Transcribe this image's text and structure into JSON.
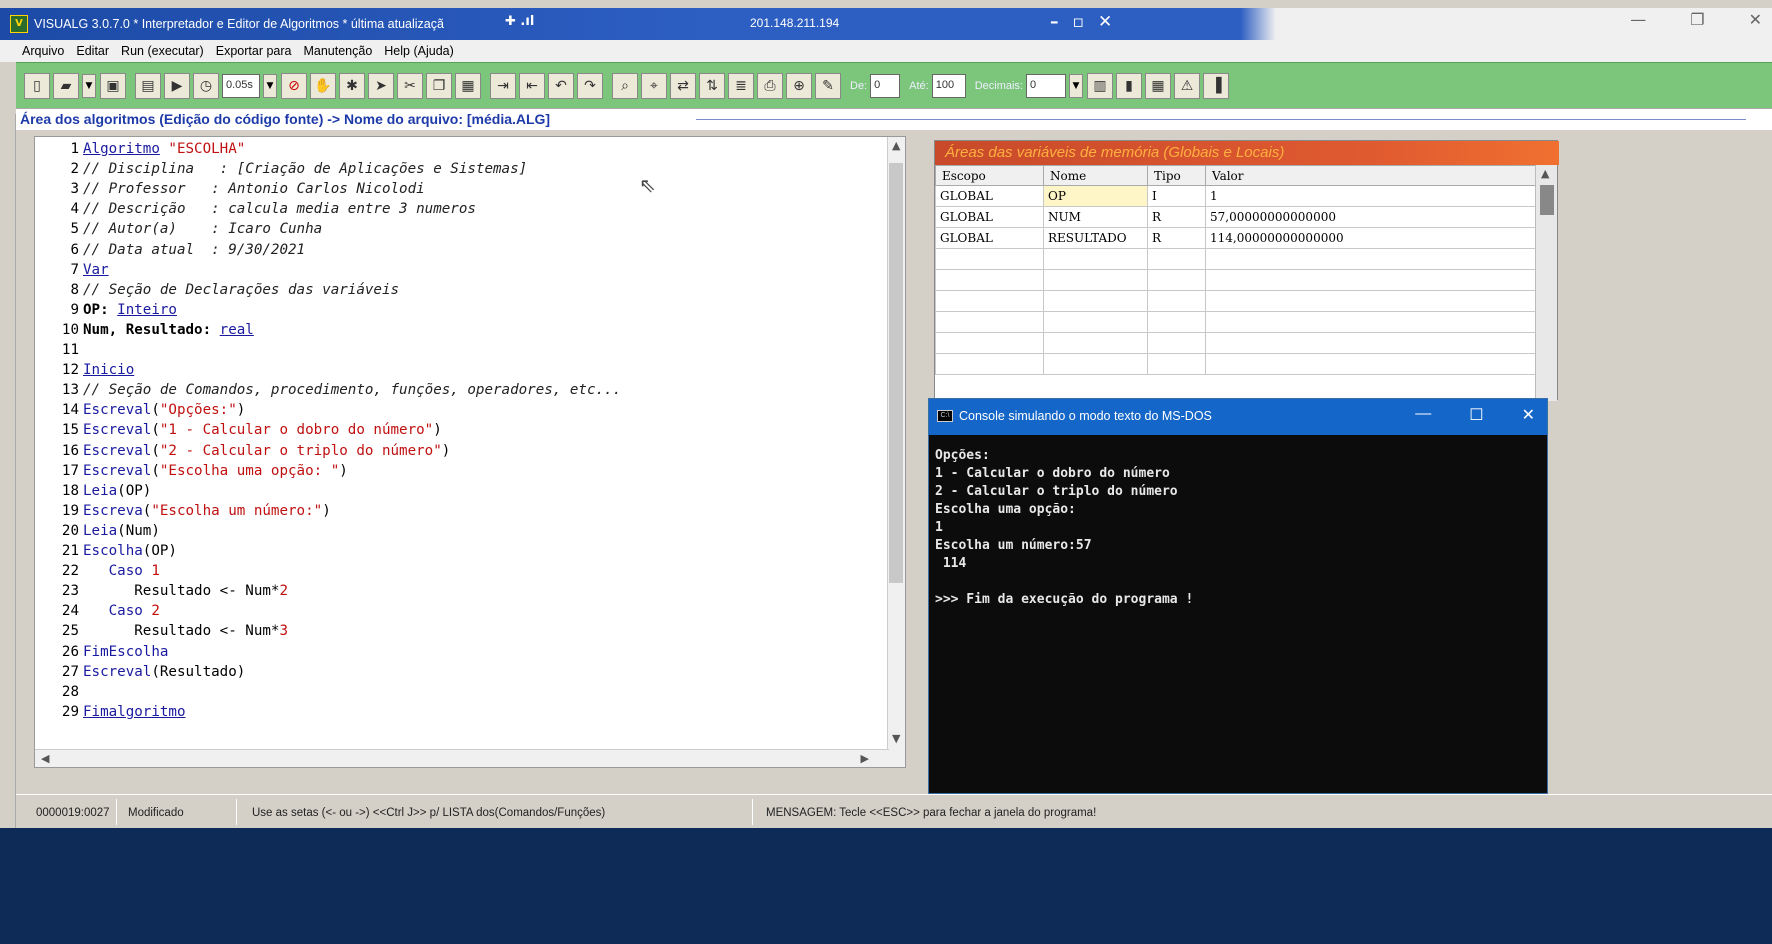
{
  "window": {
    "title": "VISUALG 3.0.7.0 * Interpretador e Editor de Algoritmos * última atualizaçã",
    "remote_ip": "201.148.211.194",
    "remote_controls": [
      "–",
      "▫",
      "✕"
    ],
    "window_controls": [
      "—",
      "❐",
      "✕"
    ]
  },
  "menu": [
    "Arquivo",
    "Editar",
    "Run (executar)",
    "Exportar para",
    "Manutenção",
    "Help (Ajuda)"
  ],
  "toolbar": {
    "speed_value": "0.05s",
    "de_label": "De:",
    "de_value": "0",
    "ate_label": "Até:",
    "ate_value": "100",
    "decimais_label": "Decimais:",
    "decimais_value": "0"
  },
  "area_header": "Área dos algoritmos (Edição do código fonte) -> Nome do arquivo: [média.ALG]",
  "code": [
    {
      "n": "1",
      "parts": [
        [
          "kw",
          "Algoritmo"
        ],
        [
          "txt",
          " "
        ],
        [
          "str",
          "\"ESCOLHA\""
        ]
      ]
    },
    {
      "n": "2",
      "parts": [
        [
          "cm",
          "// Disciplina   : [Criação de Aplicações e Sistemas]"
        ]
      ]
    },
    {
      "n": "3",
      "parts": [
        [
          "cm",
          "// Professor   : Antonio Carlos Nicolodi"
        ]
      ]
    },
    {
      "n": "4",
      "parts": [
        [
          "cm",
          "// Descrição   : calcula media entre 3 numeros"
        ]
      ]
    },
    {
      "n": "5",
      "parts": [
        [
          "cm",
          "// Autor(a)    : Icaro Cunha"
        ]
      ]
    },
    {
      "n": "6",
      "parts": [
        [
          "cm",
          "// Data atual  : 9/30/2021"
        ]
      ]
    },
    {
      "n": "7",
      "parts": [
        [
          "kw",
          "Var"
        ]
      ]
    },
    {
      "n": "8",
      "parts": [
        [
          "cm",
          "// Seção de Declarações das variáveis"
        ]
      ]
    },
    {
      "n": "9",
      "parts": [
        [
          "bold",
          "OP: "
        ],
        [
          "kw",
          "Inteiro"
        ]
      ]
    },
    {
      "n": "10",
      "parts": [
        [
          "bold",
          "Num, Resultado: "
        ],
        [
          "kw",
          "real"
        ]
      ]
    },
    {
      "n": "11",
      "parts": []
    },
    {
      "n": "12",
      "parts": [
        [
          "kw",
          "Inicio"
        ]
      ]
    },
    {
      "n": "13",
      "parts": [
        [
          "cm",
          "// Seção de Comandos, procedimento, funções, operadores, etc..."
        ]
      ]
    },
    {
      "n": "14",
      "parts": [
        [
          "fn",
          "Escreval"
        ],
        [
          "txt",
          "("
        ],
        [
          "str",
          "\"Opções:\""
        ],
        [
          "txt",
          ")"
        ]
      ]
    },
    {
      "n": "15",
      "parts": [
        [
          "fn",
          "Escreval"
        ],
        [
          "txt",
          "("
        ],
        [
          "str",
          "\"1 - Calcular o dobro do número\""
        ],
        [
          "txt",
          ")"
        ]
      ]
    },
    {
      "n": "16",
      "parts": [
        [
          "fn",
          "Escreval"
        ],
        [
          "txt",
          "("
        ],
        [
          "str",
          "\"2 - Calcular o triplo do número\""
        ],
        [
          "txt",
          ")"
        ]
      ]
    },
    {
      "n": "17",
      "parts": [
        [
          "fn",
          "Escreval"
        ],
        [
          "txt",
          "("
        ],
        [
          "str",
          "\"Escolha uma opção: \""
        ],
        [
          "txt",
          ")"
        ]
      ]
    },
    {
      "n": "18",
      "parts": [
        [
          "fn",
          "Leia"
        ],
        [
          "txt",
          "(OP)"
        ]
      ]
    },
    {
      "n": "19",
      "parts": [
        [
          "fn",
          "Escreva"
        ],
        [
          "txt",
          "("
        ],
        [
          "str",
          "\"Escolha um número:\""
        ],
        [
          "txt",
          ")"
        ]
      ]
    },
    {
      "n": "20",
      "parts": [
        [
          "fn",
          "Leia"
        ],
        [
          "txt",
          "(Num)"
        ]
      ]
    },
    {
      "n": "21",
      "parts": [
        [
          "fn",
          "Escolha"
        ],
        [
          "txt",
          "(OP)"
        ]
      ]
    },
    {
      "n": "22",
      "parts": [
        [
          "txt",
          "   "
        ],
        [
          "fn",
          "Caso "
        ],
        [
          "nm",
          "1"
        ]
      ]
    },
    {
      "n": "23",
      "parts": [
        [
          "txt",
          "      Resultado <- Num*"
        ],
        [
          "nm",
          "2"
        ]
      ]
    },
    {
      "n": "24",
      "parts": [
        [
          "txt",
          "   "
        ],
        [
          "fn",
          "Caso "
        ],
        [
          "nm",
          "2"
        ]
      ]
    },
    {
      "n": "25",
      "parts": [
        [
          "txt",
          "      Resultado <- Num*"
        ],
        [
          "nm",
          "3"
        ]
      ]
    },
    {
      "n": "26",
      "parts": [
        [
          "fn",
          "FimEscolha"
        ]
      ]
    },
    {
      "n": "27",
      "parts": [
        [
          "fn",
          "Escreval"
        ],
        [
          "txt",
          "(Resultado)"
        ]
      ]
    },
    {
      "n": "28",
      "parts": []
    },
    {
      "n": "29",
      "parts": [
        [
          "kw",
          "Fimalgoritmo"
        ]
      ]
    }
  ],
  "vars_panel": {
    "title": "Áreas das variáveis de memória (Globais e Locais)",
    "columns": [
      "Escopo",
      "Nome",
      "Tipo",
      "Valor"
    ],
    "rows": [
      [
        "GLOBAL",
        "OP",
        "I",
        "1"
      ],
      [
        "GLOBAL",
        "NUM",
        "R",
        "57,00000000000000"
      ],
      [
        "GLOBAL",
        "RESULTADO",
        "R",
        "114,00000000000000"
      ]
    ],
    "empty_rows": 6
  },
  "console": {
    "title": "Console simulando o modo texto do MS-DOS",
    "lines": [
      "Opções:",
      "1 - Calcular o dobro do número",
      "2 - Calcular o triplo do número",
      "Escolha uma opção:",
      "1",
      "Escolha um número:57",
      " 114",
      "",
      ">>> Fim da execução do programa !"
    ]
  },
  "status": {
    "position": "0000019:0027",
    "state": "Modificado",
    "hint": "Use as setas (<- ou ->) <<Ctrl J>> p/ LISTA dos(Comandos/Funções)",
    "message": "MENSAGEM: Tecle <<ESC>> para fechar a janela do programa!"
  }
}
